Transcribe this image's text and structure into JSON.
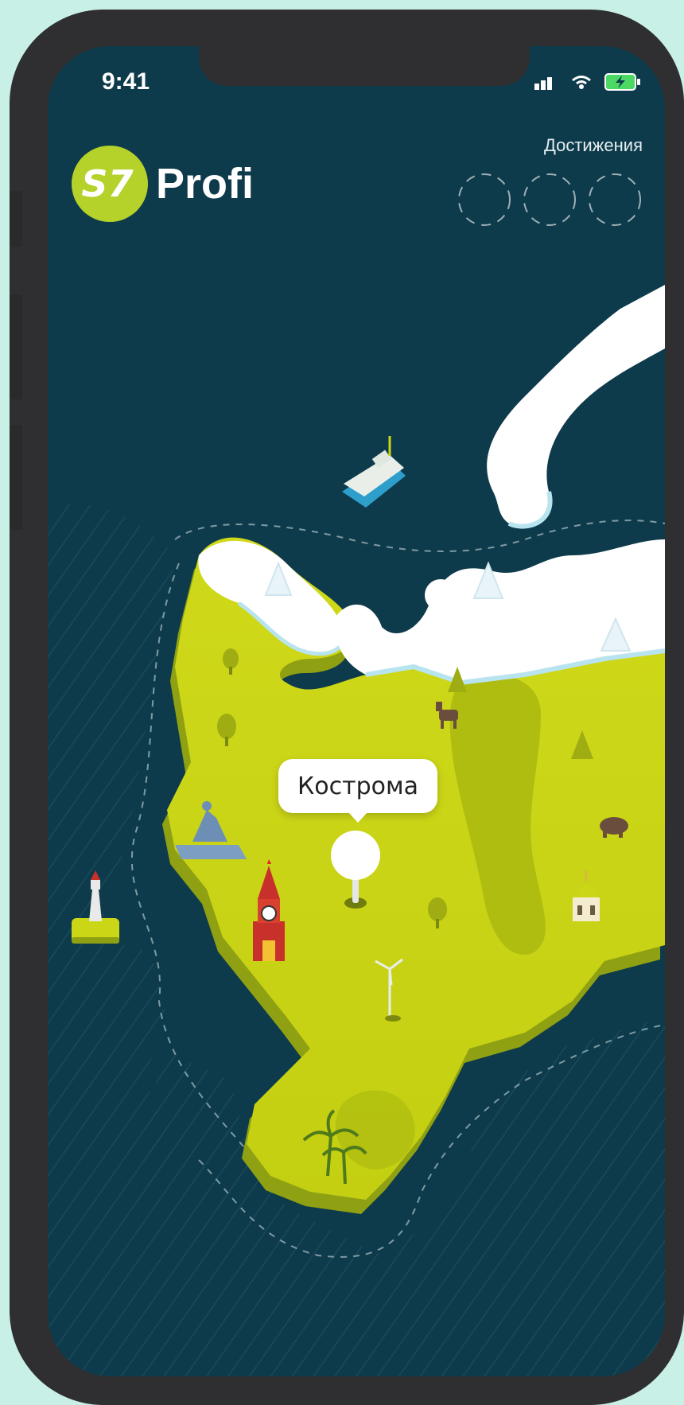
{
  "status_bar": {
    "time": "9:41",
    "icons": [
      "signal-icon",
      "wifi-icon",
      "battery-charging-icon"
    ]
  },
  "logo": {
    "mark": "S7",
    "text": "Profi"
  },
  "achievements": {
    "title": "Достижения",
    "slots": 3
  },
  "map": {
    "selected_city": "Кострома",
    "landmarks": [
      "ship-icon",
      "moose-icon",
      "bear-icon",
      "peter-monument-icon",
      "kremlin-tower-icon",
      "wind-turbine-icon",
      "church-icon",
      "lighthouse-icon",
      "palm-trees-icon",
      "pine-tree-icon"
    ]
  },
  "colors": {
    "background": "#c9f0e6",
    "sea": "#0e3b4b",
    "land": "#cbd617",
    "ice": "#ffffff",
    "brand": "#b5d22a"
  }
}
